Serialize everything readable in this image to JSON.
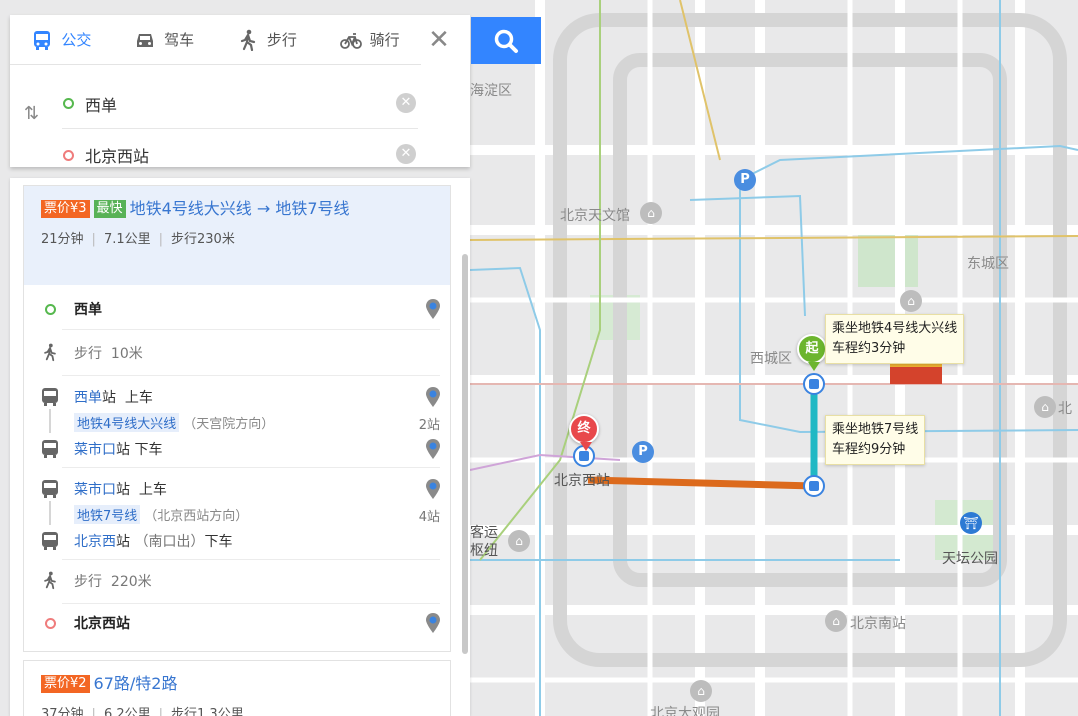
{
  "search": {
    "tabs": [
      {
        "label": "公交",
        "icon": "bus-icon",
        "active": true
      },
      {
        "label": "驾车",
        "icon": "car-icon",
        "active": false
      },
      {
        "label": "步行",
        "icon": "walk-icon",
        "active": false
      },
      {
        "label": "骑行",
        "icon": "bike-icon",
        "active": false
      }
    ],
    "from_value": "西单",
    "to_value": "北京西站"
  },
  "routes": [
    {
      "price_tag": "票价¥3",
      "fast_tag": "最快",
      "title": "地铁4号线大兴线 → 地铁7号线",
      "duration": "21分钟",
      "distance": "7.1公里",
      "walk": "步行230米",
      "steps": {
        "start": "西单",
        "walk1_label": "步行",
        "walk1_dist": "10米",
        "board1_station": "西单",
        "board1_suffix": "站",
        "board1_action": "上车",
        "line1_name": "地铁4号线大兴线",
        "line1_dir": "（天宫院方向）",
        "line1_stops": "2站",
        "alight1_station": "菜市口",
        "alight1_suffix": "站",
        "alight1_action": "下车",
        "board2_station": "菜市口",
        "board2_suffix": "站",
        "board2_action": "上车",
        "line2_name": "地铁7号线",
        "line2_dir": "（北京西站方向）",
        "line2_stops": "4站",
        "alight2_station": "北京西",
        "alight2_suffix": "站",
        "alight2_exit": "（南口出）",
        "alight2_action": "下车",
        "walk2_label": "步行",
        "walk2_dist": "220米",
        "end": "北京西站"
      }
    },
    {
      "price_tag": "票价¥2",
      "title": "67路/特2路",
      "duration": "37分钟",
      "distance": "6.2公里",
      "walk": "步行1.3公里"
    }
  ],
  "map": {
    "labels": {
      "district1": "西城区",
      "district2": "东城区",
      "district3": "海淀区",
      "planetarium": "北京天文馆",
      "xicheng": "西城区",
      "bjwest": "北京西站",
      "keyun": "客运",
      "shuniu": "枢纽",
      "tiantan": "天坛公园",
      "bjsouth": "北京南站",
      "bei": "北",
      "bottom": "北京大观园"
    },
    "tip1": {
      "line1": "乘坐地铁4号线大兴线",
      "line2": "车程约3分钟"
    },
    "tip2": {
      "line1": "乘坐地铁7号线",
      "line2": "车程约9分钟"
    },
    "start_marker": "起",
    "end_marker": "终",
    "parking": "P",
    "colors": {
      "line4": "#20b8c4",
      "line7": "#dc6a1c",
      "accent": "#3385ff"
    }
  }
}
